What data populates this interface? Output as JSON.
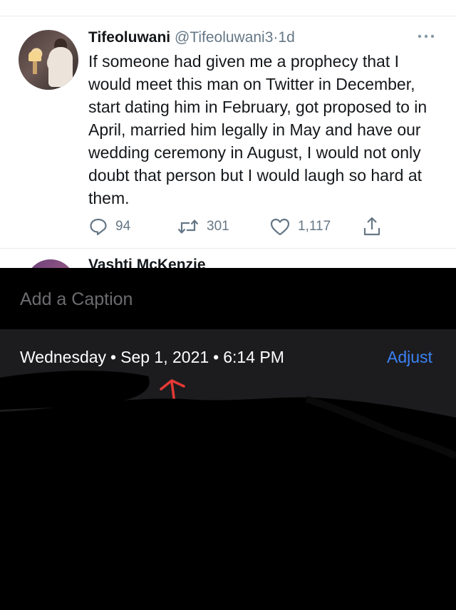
{
  "tweet": {
    "display_name": "Tifeoluwani",
    "handle": "@Tifeoluwani3",
    "dot": "·",
    "time": "1d",
    "text": "If someone had given me a prophecy that I would meet this man on Twitter in December, start dating him in February, got proposed to in April, married him legally in May and have our wedding ceremony in August, I would not only doubt that person but I would laugh so hard at them.",
    "actions": {
      "replies": "94",
      "retweets": "301",
      "likes": "1,117"
    },
    "icons": [
      "more-icon",
      "reply-icon",
      "retweet-icon",
      "like-icon",
      "share-icon"
    ]
  },
  "next_tweet": {
    "display_name_partial": "Vashti McKenzie"
  },
  "photo_info": {
    "caption_placeholder": "Add a Caption",
    "day": "Wednesday",
    "date": "Sep 1, 2021",
    "time": "6:14 PM",
    "separator": "•",
    "adjust_label": "Adjust"
  },
  "colors": {
    "tweet_text": "#14171a",
    "secondary_text": "#657786",
    "adjust_blue": "#3b82f6",
    "annotation_red": "#e53935",
    "panel_bg": "#1c1c1e"
  }
}
